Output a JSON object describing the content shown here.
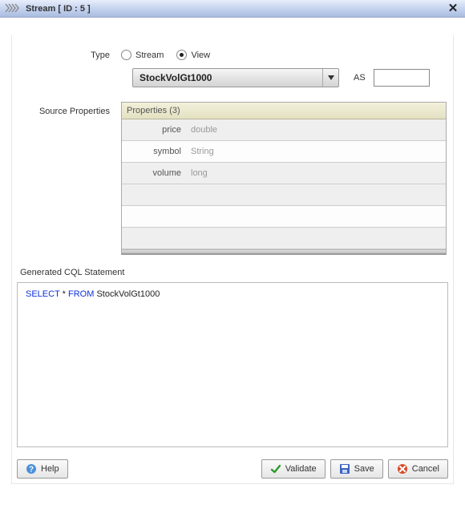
{
  "titlebar": {
    "title": "Stream [ ID : 5 ]"
  },
  "form": {
    "type_label": "Type",
    "radio_stream": "Stream",
    "radio_view": "View",
    "selected_type": "View",
    "select_value": "StockVolGt1000",
    "as_label": "AS",
    "as_value": ""
  },
  "properties": {
    "section_label": "Source Properties",
    "header": "Properties (3)",
    "rows": [
      {
        "name": "price",
        "type": "double"
      },
      {
        "name": "symbol",
        "type": "String"
      },
      {
        "name": "volume",
        "type": "long"
      }
    ]
  },
  "cql": {
    "label": "Generated CQL Statement",
    "kw1": "SELECT",
    "star": " * ",
    "kw2": "FROM",
    "rest": " StockVolGt1000"
  },
  "buttons": {
    "help": "Help",
    "validate": "Validate",
    "save": "Save",
    "cancel": "Cancel"
  }
}
